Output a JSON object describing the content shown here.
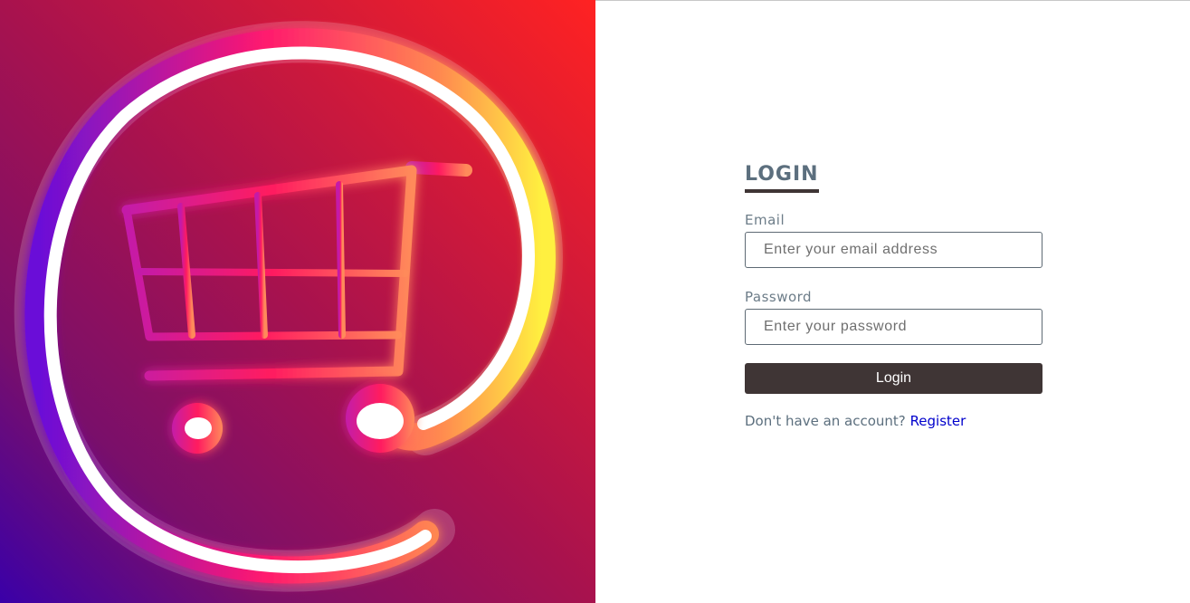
{
  "colors": {
    "hero_gradient_top_right": "#ff2222",
    "hero_gradient_bottom_left": "#3a00a8",
    "title_color": "#5c6f7e",
    "button_bg": "#3f3535",
    "link_color": "#0000cc"
  },
  "hero": {
    "icon": "shopping-cart-at-sign-logo-icon"
  },
  "login_form": {
    "title": "LOGIN",
    "email_label": "Email",
    "email_placeholder": "Enter your email address",
    "email_value": "",
    "password_label": "Password",
    "password_placeholder": "Enter your password",
    "password_value": "",
    "submit_label": "Login",
    "register_prompt": "Don't have an account?",
    "register_link": "Register"
  }
}
